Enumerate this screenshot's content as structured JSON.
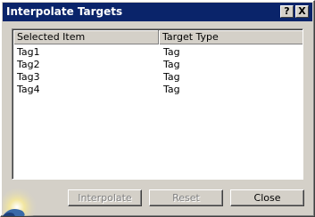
{
  "window": {
    "title": "Interpolate Targets",
    "help_glyph": "?",
    "close_glyph": "X"
  },
  "table": {
    "columns": [
      "Selected Item",
      "Target Type"
    ],
    "rows": [
      [
        "Tag1",
        "Tag"
      ],
      [
        "Tag2",
        "Tag"
      ],
      [
        "Tag3",
        "Tag"
      ],
      [
        "Tag4",
        "Tag"
      ]
    ]
  },
  "buttons": {
    "interpolate": {
      "label": "Interpolate",
      "enabled": false
    },
    "reset": {
      "label": "Reset",
      "enabled": false
    },
    "close": {
      "label": "Close",
      "enabled": true
    }
  },
  "colors": {
    "titlebar": "#0a246a",
    "face": "#d4d0c8",
    "disabled_text": "#808080"
  }
}
